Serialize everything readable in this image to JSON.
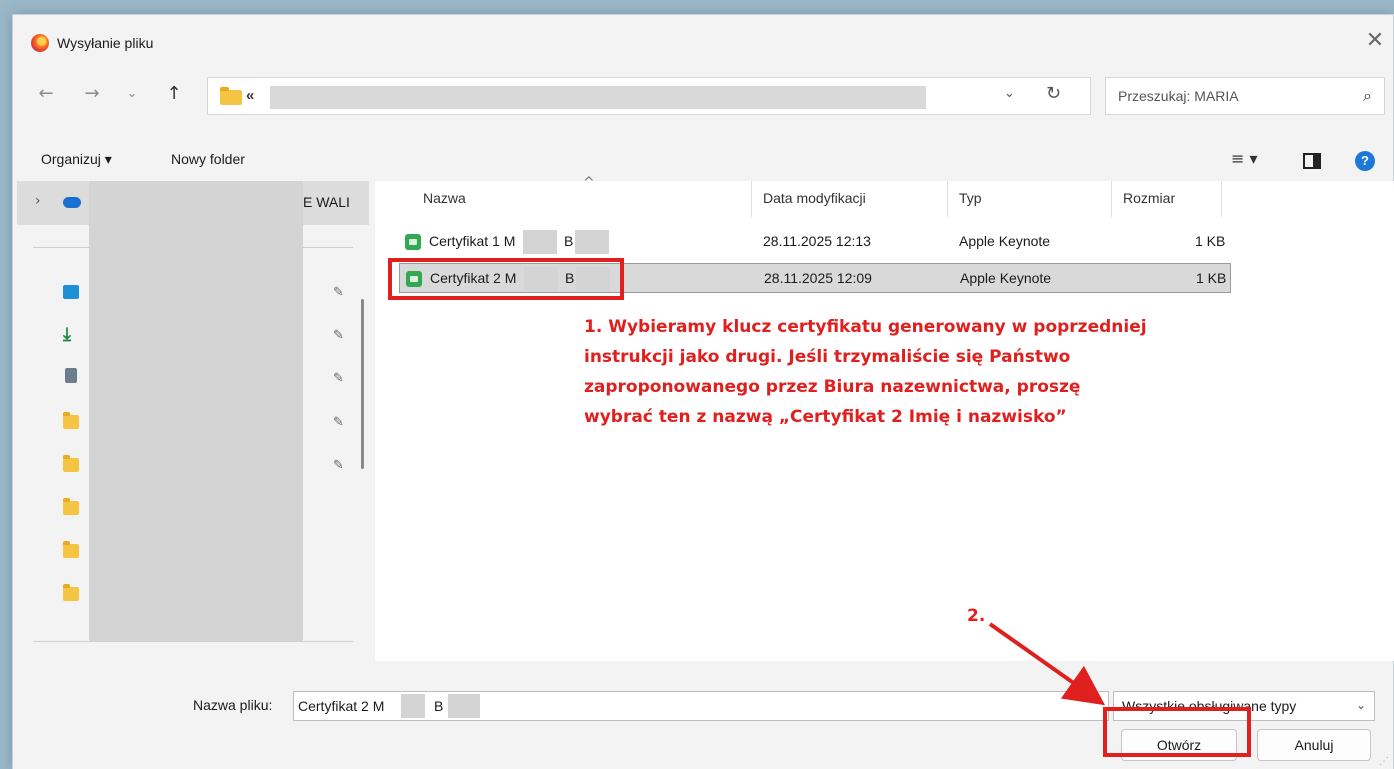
{
  "window": {
    "title": "Wysyłanie pliku"
  },
  "nav": {
    "address_prefix": "«",
    "search_placeholder": "Przeszukaj: MARIA"
  },
  "toolbar": {
    "organize": "Organizuj ▾",
    "new_folder": "Nowy folder"
  },
  "sidebar": {
    "top_label": "E WALI"
  },
  "columns": {
    "name": "Nazwa",
    "date": "Data modyfikacji",
    "type": "Typ",
    "size": "Rozmiar"
  },
  "files": [
    {
      "name": "Certyfikat 1 M",
      "name_suffix": "B",
      "date": "28.11.2025 12:13",
      "type": "Apple Keynote",
      "size": "1 KB",
      "selected": false
    },
    {
      "name": "Certyfikat 2 M",
      "name_suffix": "B",
      "date": "28.11.2025 12:09",
      "type": "Apple Keynote",
      "size": "1 KB",
      "selected": true
    }
  ],
  "annotations": {
    "step1": [
      "1. Wybieramy klucz certyfikatu generowany w poprzedniej",
      "instrukcji jako drugi. Jeśli trzymaliście się Państwo",
      "zaproponowanego przez Biura nazewnictwa, proszę",
      "wybrać ten z nazwą „Certyfikat 2 Imię i nazwisko”"
    ],
    "step2": "2.",
    "color": "#e0201e"
  },
  "bottom": {
    "filename_label": "Nazwa pliku:",
    "filename_value": "Certyfikat 2 M",
    "filename_suffix": "B",
    "filter_value": "Wszystkie obsługiwane typy",
    "open_button": "Otwórz",
    "cancel_button": "Anuluj"
  }
}
